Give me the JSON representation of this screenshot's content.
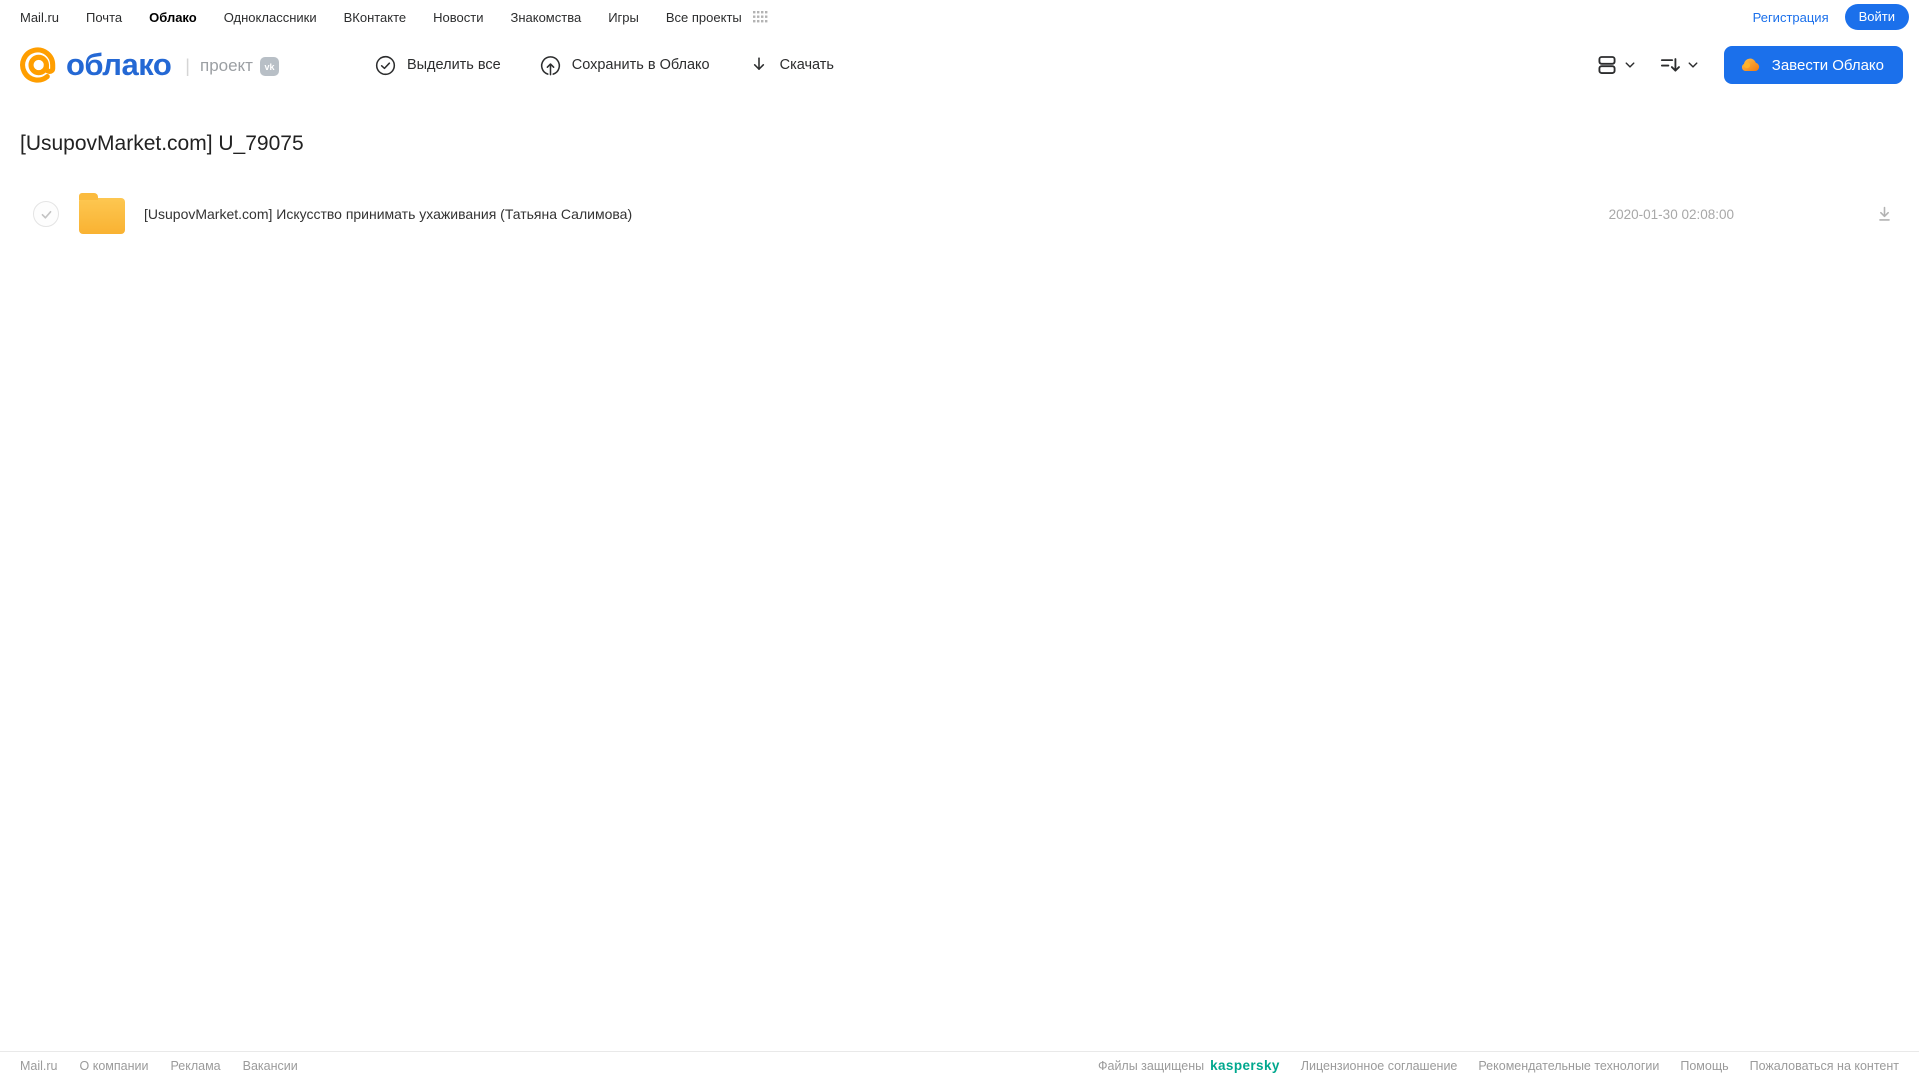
{
  "topnav": {
    "items": [
      {
        "label": "Mail.ru"
      },
      {
        "label": "Почта"
      },
      {
        "label": "Облако",
        "active": true
      },
      {
        "label": "Одноклассники"
      },
      {
        "label": "ВКонтакте"
      },
      {
        "label": "Новости"
      },
      {
        "label": "Знакомства"
      },
      {
        "label": "Игры"
      },
      {
        "label": "Все проекты"
      }
    ],
    "registration_label": "Регистрация",
    "login_label": "Войти"
  },
  "header": {
    "logo_at": "@",
    "logo_text": "облако",
    "project_label": "проект",
    "vk_badge": "vk",
    "toolbar": {
      "select_all": "Выделить все",
      "save_to_cloud": "Сохранить в Облако",
      "download": "Скачать"
    },
    "get_cloud_label": "Завести Облако"
  },
  "main": {
    "title": "[UsupovMarket.com] U_79075",
    "files": [
      {
        "type": "folder",
        "name": "[UsupovMarket.com] Искусство принимать ухаживания (Татьяна Салимова)",
        "date": "2020-01-30 02:08:00"
      }
    ]
  },
  "footer": {
    "left_links": [
      "Mail.ru",
      "О компании",
      "Реклама",
      "Вакансии"
    ],
    "protected_label": "Файлы защищены",
    "kaspersky_label": "kaspersky",
    "right_links": [
      "Лицензионное соглашение",
      "Рекомендательные технологии",
      "Помощь",
      "Пожаловаться на контент"
    ]
  },
  "colors": {
    "accent_blue": "#1b70eb",
    "logo_blue": "#2468d4",
    "logo_orange": "#ff9e00",
    "folder_yellow": "#fbbb3e",
    "kaspersky_teal": "#00a88e"
  }
}
